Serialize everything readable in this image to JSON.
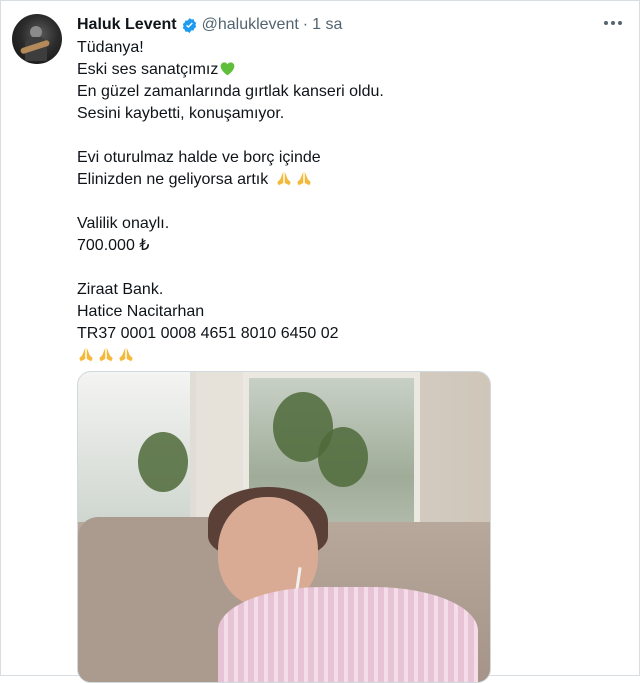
{
  "tweet": {
    "author_name": "Haluk Levent",
    "handle": "@haluklevent",
    "separator": "·",
    "time": "1 sa",
    "lines": [
      "Tüdanya!",
      "Eski ses sanatçımız",
      "En güzel zamanlarında gırtlak kanseri oldu.",
      "Sesini kaybetti, konuşamıyor.",
      "",
      "Evi oturulmaz halde ve borç içinde",
      "Elinizden ne geliyorsa artık",
      "",
      "Valilik onaylı.",
      "700.000 ₺",
      "",
      "Ziraat Bank.",
      "Hatice Nacitarhan",
      "TR37 0001 0008 4651 8010 6450 02"
    ],
    "emoji": {
      "heart": "green-heart",
      "pray": "folded-hands"
    }
  },
  "colors": {
    "text": "#0f1419",
    "muted": "#536471",
    "verified": "#1d9bf0",
    "heart": "#5fbf3a",
    "pray": "#f5b93a"
  }
}
